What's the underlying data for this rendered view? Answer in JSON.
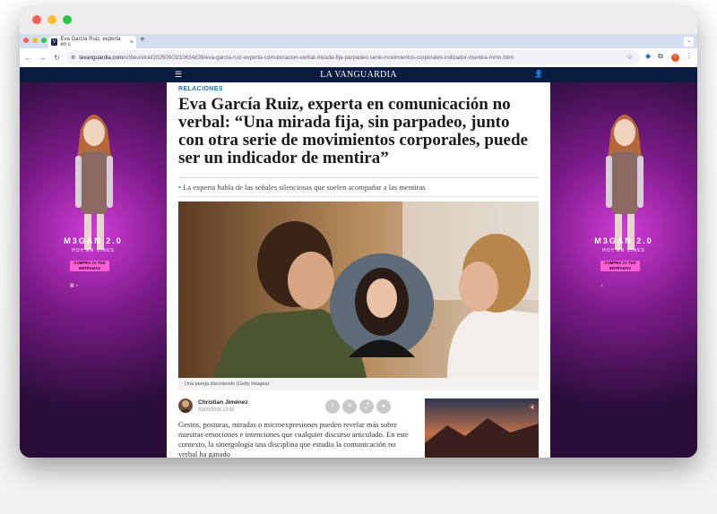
{
  "browser": {
    "tab_title": "Eva García Ruiz, experta en c",
    "tab_favicon": "V",
    "tab_close": "×",
    "new_tab": "+",
    "url_host": "lavanguardia.com",
    "url_path": "/cribeo/viral/20250503/10634839/eva-garcia-ruiz-experta-comunicacion-verbal-mirada-fija-parpadeo-serie-movimientos-corporales-indicador-mentira-mmn.html",
    "profile_initial": "I"
  },
  "site": {
    "brand": "LA VANGUARDIA"
  },
  "ad": {
    "title": "M3GAN 2.0",
    "subtitle": "HOY EN CINES",
    "cta": "COMPRA YA TUS ENTRADAS"
  },
  "article": {
    "kicker": "RELACIONES",
    "headline": "Eva García Ruiz, experta en comunicación no verbal: “Una mirada fija, sin parpadeo, junto con otra serie de movimientos corporales, puede ser un indicador de mentira”",
    "lead": "La experta habla de las señales silenciosas que suelen acompañar a las mentiras",
    "caption": "Una pareja discutiendo (Getty Images)",
    "author_name": "Christian Jiménez",
    "author_date": "03/05/2025 13:00",
    "body": "Gestos, posturas, miradas o microexpresiones pueden revelar más sobre nuestras emociones e intenciones que cualquier discurso articulado. En este contexto, la sinergología una disciplina que estudia la comunicación no verbal ha ganado"
  },
  "colors": {
    "nav": "#0a1c40",
    "kicker": "#2b6cb0",
    "ad_bg": "#2a0d3a",
    "ad_glow": "#d23bd8",
    "ad_button": "#ff5fd4"
  },
  "icons": [
    "hamburger-icon",
    "user-icon",
    "facebook-icon",
    "twitter-icon",
    "share-icon",
    "comment-icon",
    "star-icon",
    "extensions-icon",
    "mute-icon"
  ]
}
